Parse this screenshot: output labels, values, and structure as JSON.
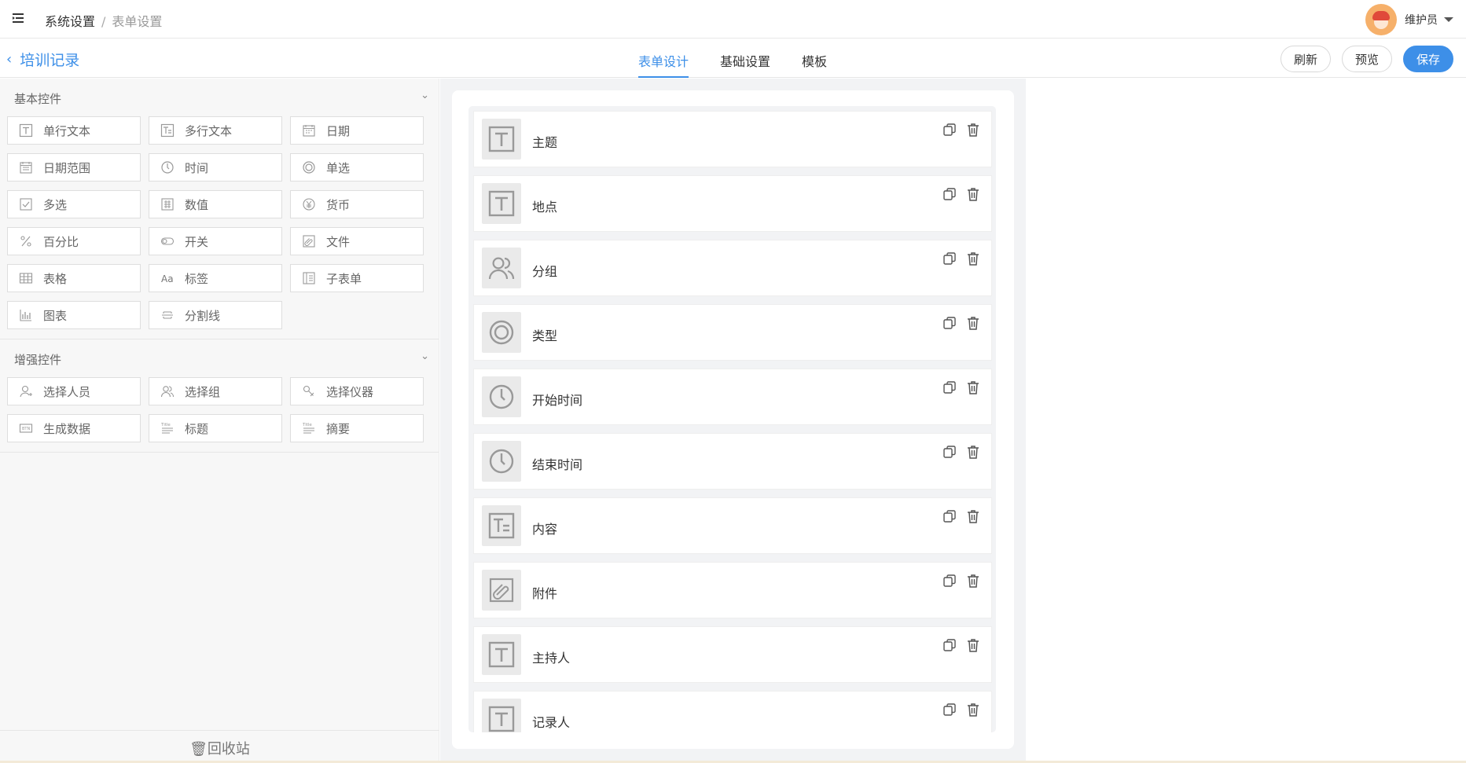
{
  "breadcrumb": {
    "root": "系统设置",
    "separator": "/",
    "current": "表单设置"
  },
  "user": {
    "name": "维护员"
  },
  "subheader": {
    "back_label": "培训记录",
    "tabs": [
      {
        "label": "表单设计",
        "active": true
      },
      {
        "label": "基础设置",
        "active": false
      },
      {
        "label": "模板",
        "active": false
      }
    ],
    "buttons": {
      "refresh": "刷新",
      "preview": "预览",
      "save": "保存"
    }
  },
  "palette": {
    "basic": {
      "title": "基本控件",
      "items": [
        {
          "label": "单行文本",
          "icon": "text-icon"
        },
        {
          "label": "多行文本",
          "icon": "multiline-text-icon"
        },
        {
          "label": "日期",
          "icon": "calendar-icon"
        },
        {
          "label": "日期范围",
          "icon": "calendar-range-icon"
        },
        {
          "label": "时间",
          "icon": "clock-icon"
        },
        {
          "label": "单选",
          "icon": "radio-icon"
        },
        {
          "label": "多选",
          "icon": "checkbox-icon"
        },
        {
          "label": "数值",
          "icon": "number-icon"
        },
        {
          "label": "货币",
          "icon": "currency-icon"
        },
        {
          "label": "百分比",
          "icon": "percent-icon"
        },
        {
          "label": "开关",
          "icon": "switch-icon"
        },
        {
          "label": "文件",
          "icon": "attachment-icon"
        },
        {
          "label": "表格",
          "icon": "table-icon"
        },
        {
          "label": "标签",
          "icon": "label-icon"
        },
        {
          "label": "子表单",
          "icon": "subform-icon"
        },
        {
          "label": "图表",
          "icon": "chart-icon"
        },
        {
          "label": "分割线",
          "icon": "divider-icon"
        }
      ]
    },
    "enhanced": {
      "title": "增强控件",
      "items": [
        {
          "label": "选择人员",
          "icon": "user-select-icon"
        },
        {
          "label": "选择组",
          "icon": "group-select-icon"
        },
        {
          "label": "选择仪器",
          "icon": "instrument-icon"
        },
        {
          "label": "生成数据",
          "icon": "generate-data-icon"
        },
        {
          "label": "标题",
          "icon": "title-icon"
        },
        {
          "label": "摘要",
          "icon": "summary-icon"
        }
      ]
    },
    "recycle_label": "回收站"
  },
  "form_fields": [
    {
      "label": "主题",
      "icon": "text-icon"
    },
    {
      "label": "地点",
      "icon": "text-icon"
    },
    {
      "label": "分组",
      "icon": "group-icon"
    },
    {
      "label": "类型",
      "icon": "radio-icon"
    },
    {
      "label": "开始时间",
      "icon": "clock-icon"
    },
    {
      "label": "结束时间",
      "icon": "clock-icon"
    },
    {
      "label": "内容",
      "icon": "multiline-text-icon"
    },
    {
      "label": "附件",
      "icon": "attachment-icon"
    },
    {
      "label": "主持人",
      "icon": "text-icon"
    },
    {
      "label": "记录人",
      "icon": "text-icon"
    }
  ],
  "colors": {
    "accent": "#3d8fe8",
    "canvas_bg": "#f2f3f5",
    "panel_bg": "#f7f7f7"
  }
}
